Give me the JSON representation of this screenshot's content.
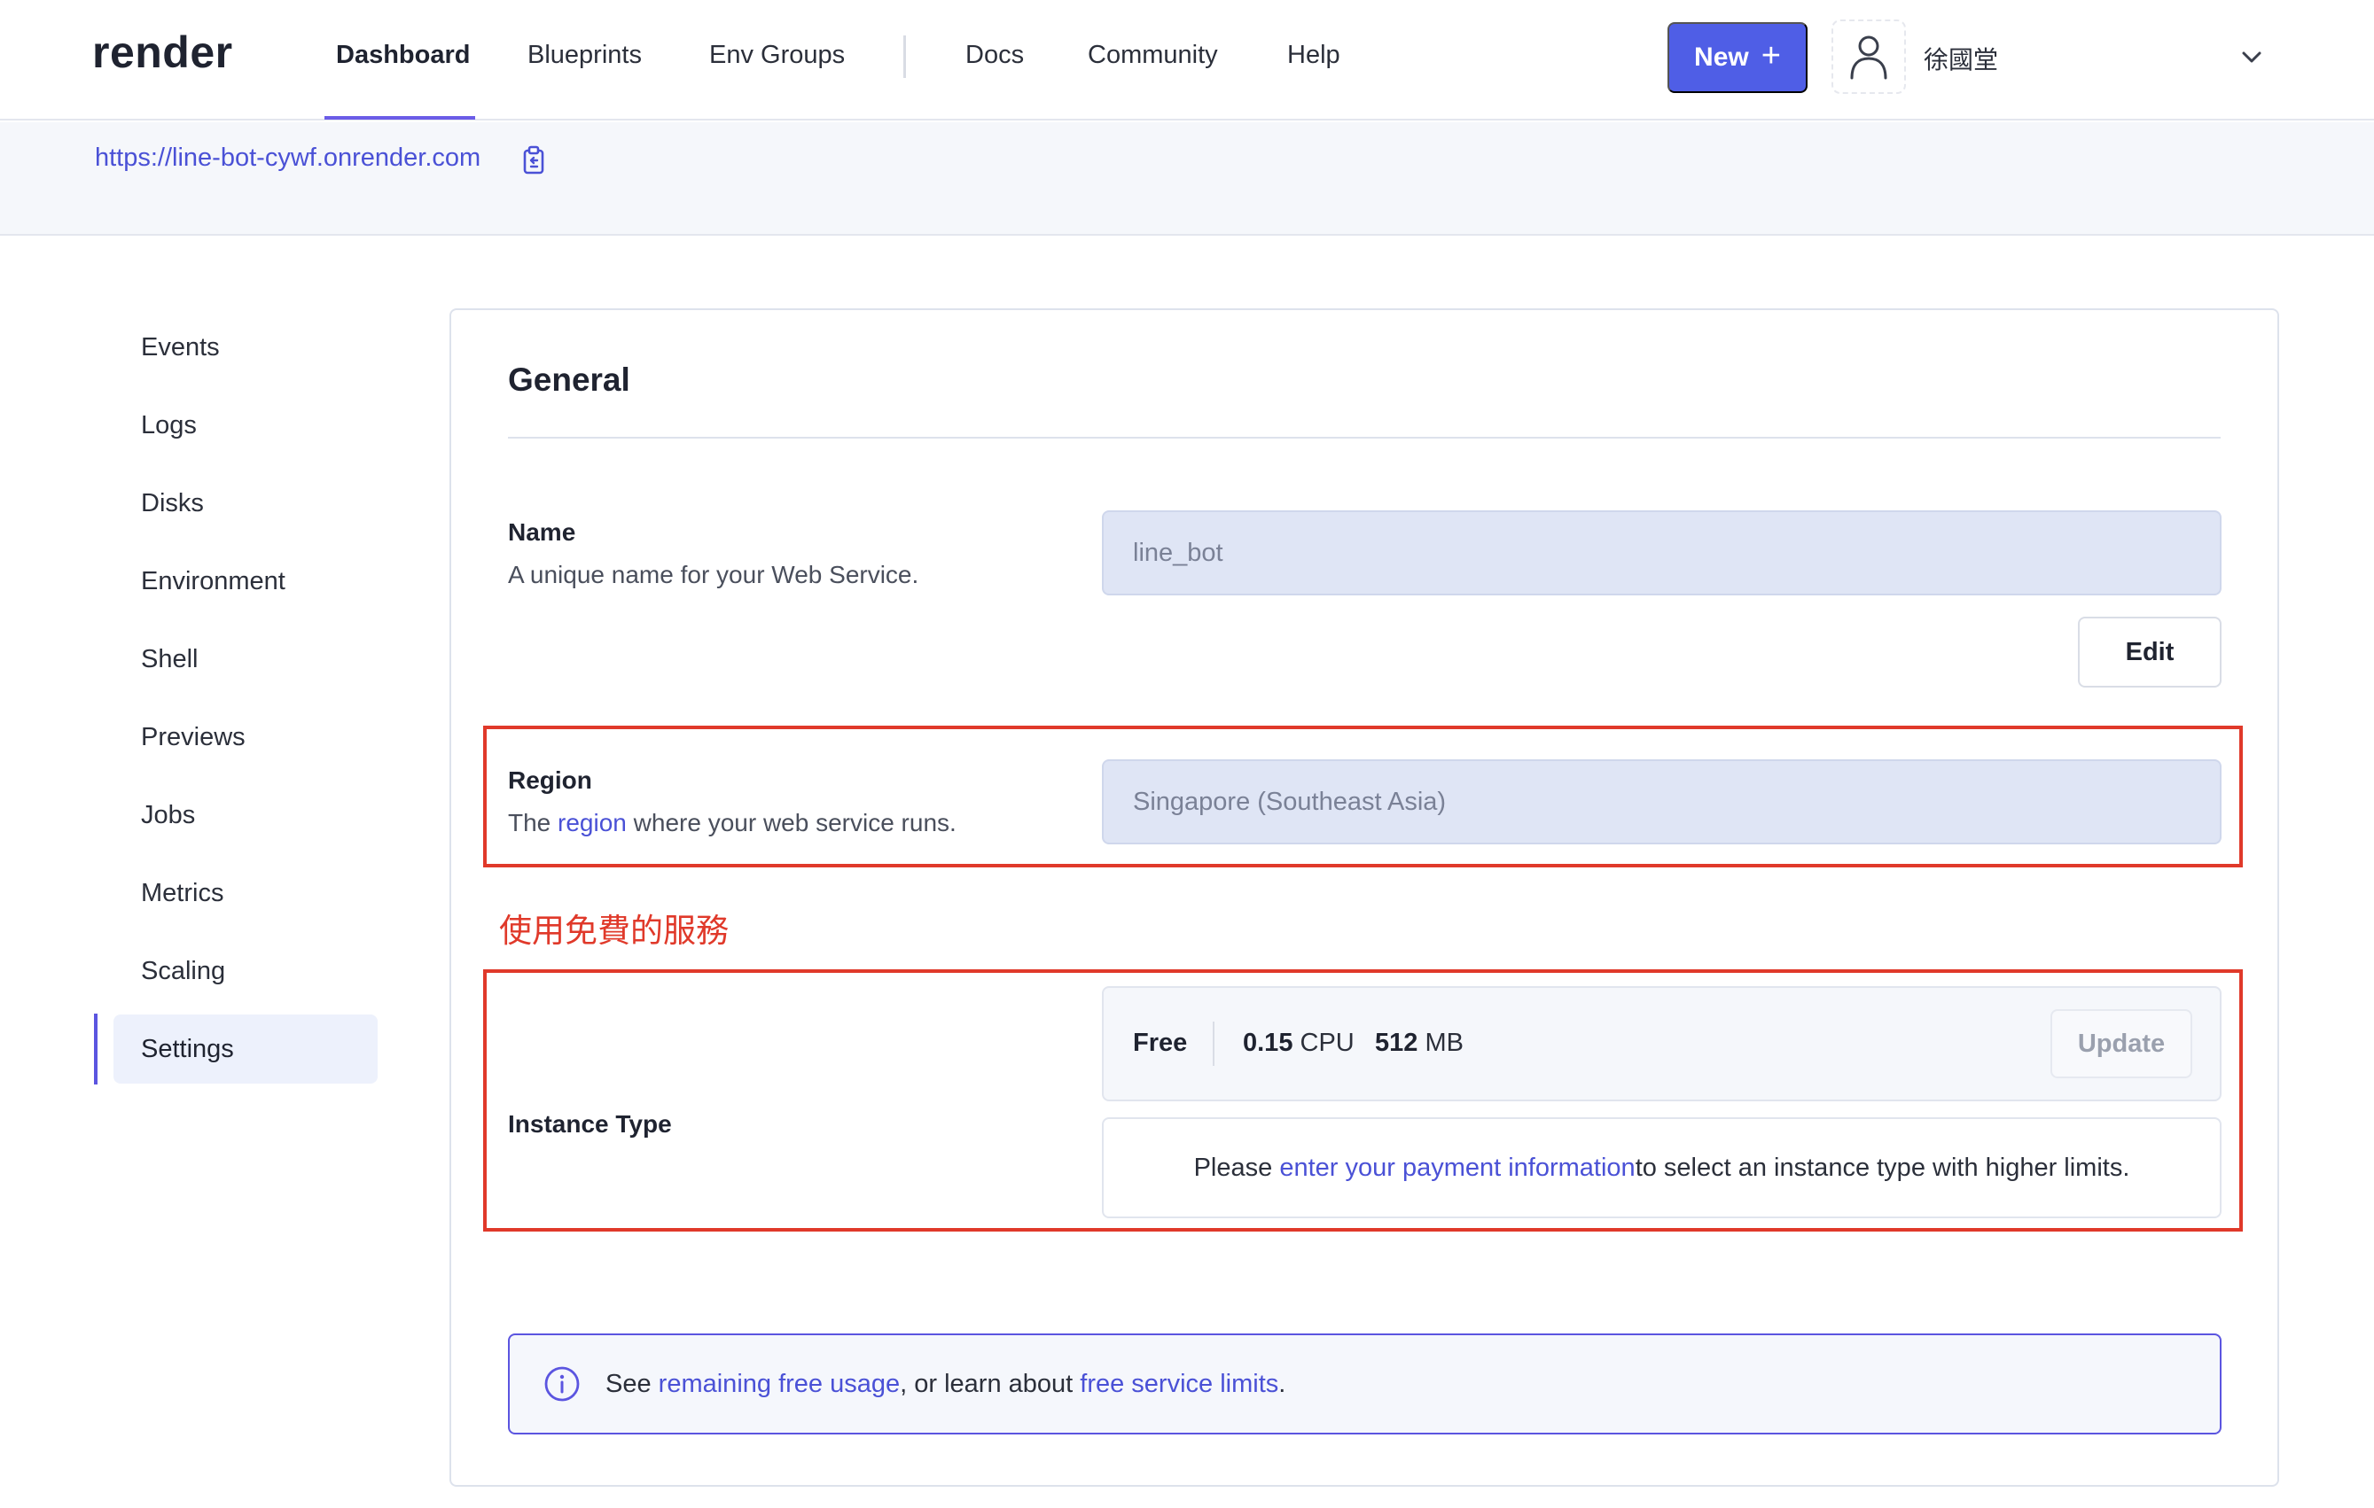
{
  "brand": {
    "logo_text": "render"
  },
  "nav": {
    "links": [
      "Dashboard",
      "Blueprints",
      "Env Groups",
      "Docs",
      "Community",
      "Help"
    ],
    "active": "Dashboard",
    "new_button_label": "New",
    "username": "徐國堂"
  },
  "service": {
    "url": "https://line-bot-cywf.onrender.com"
  },
  "sidebar": {
    "items": [
      "Events",
      "Logs",
      "Disks",
      "Environment",
      "Shell",
      "Previews",
      "Jobs",
      "Metrics",
      "Scaling",
      "Settings"
    ],
    "active": "Settings"
  },
  "general": {
    "title": "General",
    "name": {
      "label": "Name",
      "help": "A unique name for your Web Service.",
      "value": "line_bot",
      "edit_label": "Edit"
    },
    "region": {
      "label": "Region",
      "help_prefix": "The ",
      "help_link": "region",
      "help_suffix": " where your web service runs.",
      "value": "Singapore (Southeast Asia)"
    },
    "annotation": "使用免費的服務",
    "instance": {
      "label": "Instance Type",
      "tier": "Free",
      "cpu_value": "0.15",
      "cpu_unit": "CPU",
      "memory_value": "512",
      "memory_unit": "MB",
      "update_label": "Update",
      "payment_prefix": "Please ",
      "payment_link": "enter your payment information",
      "payment_suffix": " to select an instance type with higher limits."
    },
    "info": {
      "prefix": "See ",
      "link1": "remaining free usage",
      "middle": ", or learn about ",
      "link2": "free service limits",
      "suffix": "."
    }
  },
  "colors": {
    "accent": "#4f5ee6",
    "link": "#4a51d6",
    "annotation_red": "#e0392a",
    "input_bg": "#dfe5f5"
  }
}
